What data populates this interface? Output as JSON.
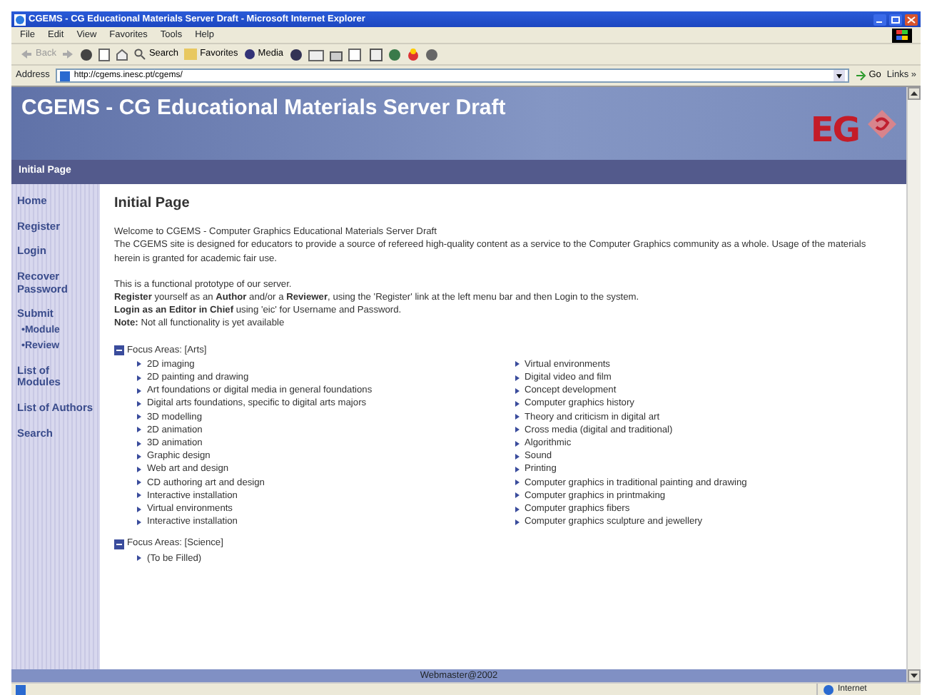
{
  "window": {
    "title": "CGEMS - CG Educational Materials Server Draft - Microsoft Internet Explorer"
  },
  "menu": [
    "File",
    "Edit",
    "View",
    "Favorites",
    "Tools",
    "Help"
  ],
  "toolbar": {
    "back": {
      "label": "Back",
      "disabled": true
    },
    "search": "Search",
    "favorites": "Favorites",
    "media": "Media"
  },
  "address": {
    "label": "Address",
    "value": "http://cgems.inesc.pt/cgems/",
    "go": "Go",
    "links": "Links »"
  },
  "banner": {
    "title": "CGEMS - CG Educational Materials Server Draft",
    "logo": "EG"
  },
  "page_bar": "Initial Page",
  "sidebar": {
    "items": [
      {
        "label": "Home"
      },
      {
        "label": "Register"
      },
      {
        "label": "Login"
      },
      {
        "label": "Recover Password"
      },
      {
        "label": "Submit",
        "children": [
          {
            "label": "•Module"
          },
          {
            "label": "•Review"
          }
        ]
      },
      {
        "label": "List of Modules"
      },
      {
        "label": "List of Authors"
      },
      {
        "label": "Search"
      }
    ]
  },
  "content": {
    "heading": "Initial Page",
    "paragraphs": [
      [
        "Welcome to CGEMS - Computer Graphics Educational Materials Server Draft",
        "The CGEMS site is designed for educators to provide a source of refereed high-quality content as a service to the Computer Graphics community as a whole. Usage of the materials herein is granted for academic fair use."
      ],
      [
        "This is a functional prototype of our server.",
        "**Register** yourself as an **Author** and/or a **Reviewer**, using the 'Register' link at the left menu bar and then Login to the system.",
        "**Login as an Editor in Chief** using 'eic' for Username and Password.",
        "**Note:** Not all functionality is yet available"
      ]
    ],
    "focus_areas": [
      {
        "title": "Focus Areas:  [Arts]",
        "columns": [
          [
            "2D imaging",
            "2D painting and drawing",
            "Art foundations or digital media in general foundations",
            "Digital arts foundations, specific to digital arts majors",
            "3D modelling",
            "2D animation",
            "3D animation",
            "Graphic design",
            "Web art and design",
            "CD authoring art and design",
            "Interactive installation",
            "Virtual environments",
            "Interactive installation"
          ],
          [
            "Virtual environments",
            "Digital video and film",
            "Concept development",
            "Computer graphics history",
            "Theory and criticism in digital art",
            "Cross media (digital and traditional)",
            "Algorithmic",
            "Sound",
            "Printing",
            "Computer graphics in traditional painting and drawing",
            "Computer graphics in printmaking",
            "Computer graphics fibers",
            "Computer graphics sculpture and jewellery"
          ]
        ]
      },
      {
        "title": "Focus Areas:  [Science]",
        "columns": [
          [
            "(To be Filled)"
          ]
        ]
      }
    ]
  },
  "footer": "Webmaster@2002",
  "status_bar": {
    "zone": "Internet"
  }
}
